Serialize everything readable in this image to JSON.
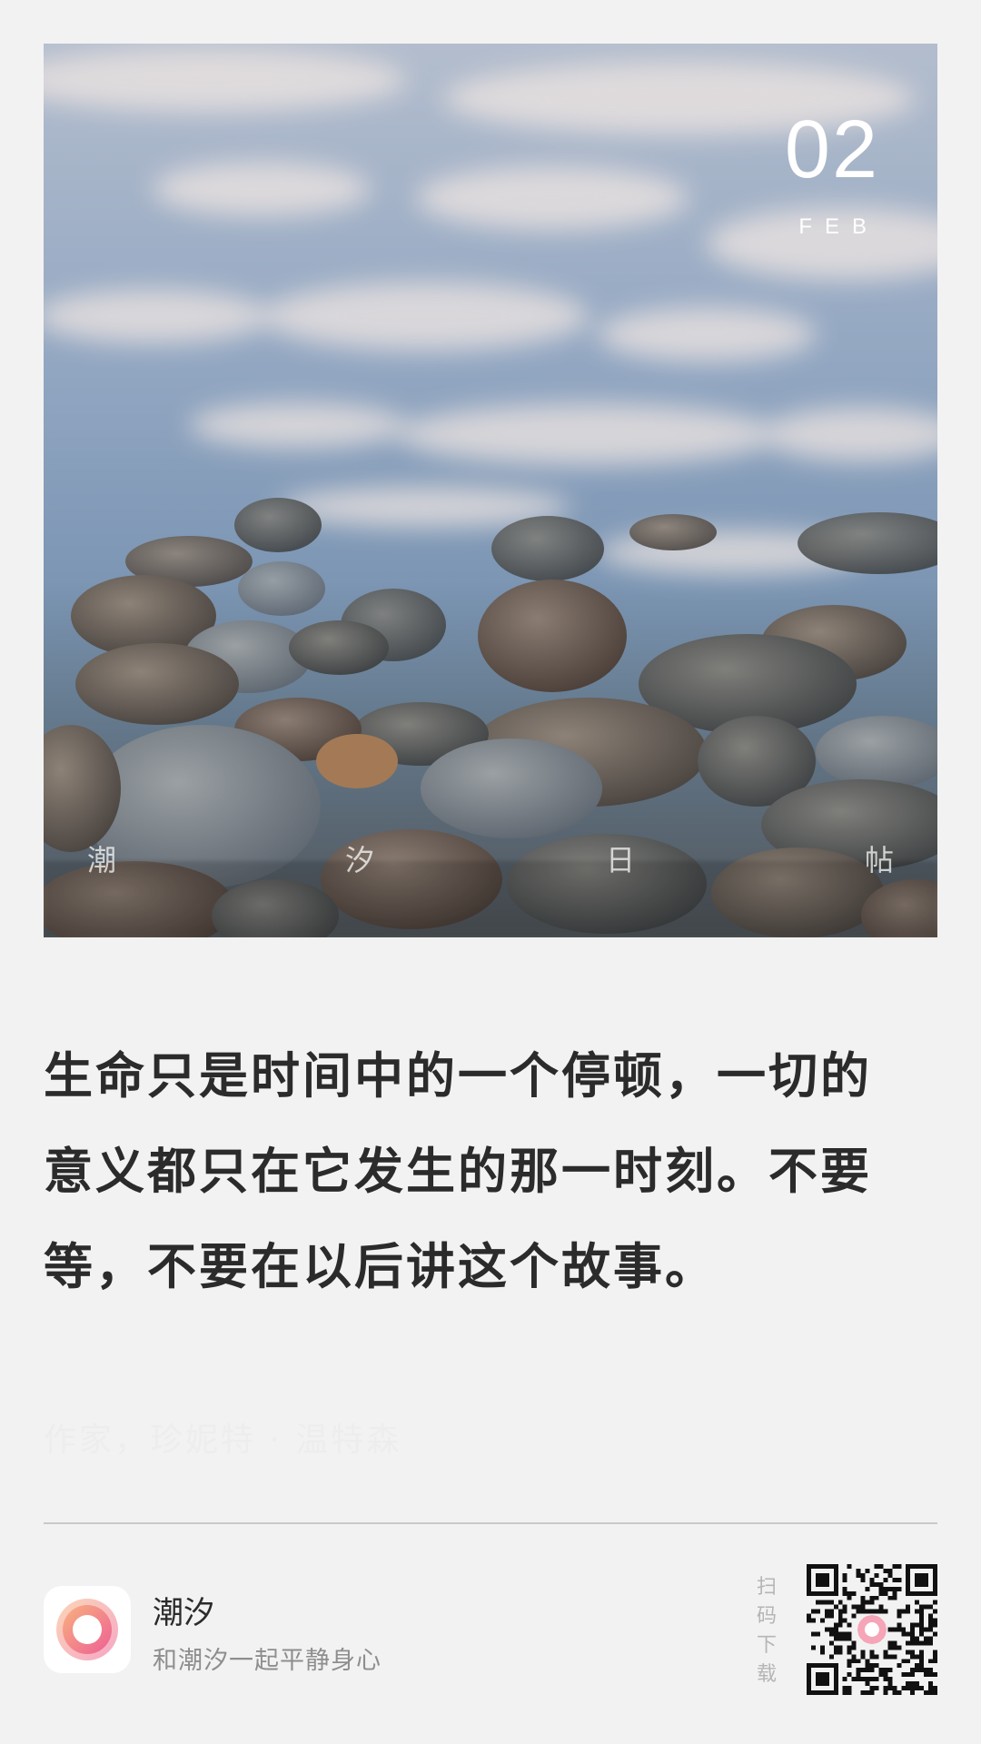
{
  "card": {
    "date": {
      "day": "02",
      "month": "FEB"
    },
    "brand_chars": [
      "潮",
      "汐",
      "日",
      "帖"
    ],
    "quote": "生命只是时间中的一个停顿，一切的意义都只在它发生的那一时刻。不要等，不要在以后讲这个故事。",
    "author": "作家，珍妮特 · 温特森"
  },
  "footer": {
    "app_name": "潮汐",
    "slogan": "和潮汐一起平静身心",
    "scan_hint": "扫码下载",
    "icons": {
      "app_logo": "tide-logo-icon",
      "qr": "qr-code-icon"
    }
  },
  "colors": {
    "background": "#f2f2f2",
    "quote_text": "#2b2b2b",
    "secondary_text": "#8e8e8e",
    "logo_gradient": [
      "#f7b27e",
      "#ee5f95"
    ]
  }
}
